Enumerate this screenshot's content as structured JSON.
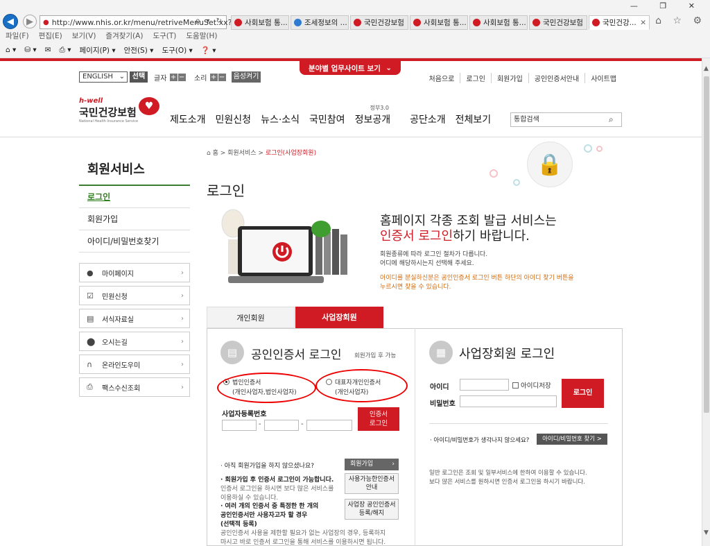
{
  "browser": {
    "address": "http://www.nhis.or.kr/menu/retriveMenuSet.xx?",
    "address_controls": "ρ ▾ ↻",
    "tabs": [
      {
        "label": "사회보험 통...",
        "icon": "red"
      },
      {
        "label": "조세정보의 ...",
        "icon": "blue"
      },
      {
        "label": "국민건강보험",
        "icon": "red"
      },
      {
        "label": "사회보험 통...",
        "icon": "red"
      },
      {
        "label": "사회보험 통...",
        "icon": "red"
      },
      {
        "label": "국민건강보험",
        "icon": "red"
      },
      {
        "label": "국민건강...",
        "icon": "red",
        "active": true
      }
    ],
    "window_controls": "— ❐ ✕",
    "toolbar_icons": "⌂ ☆ ⚙",
    "menubar": [
      "파일(F)",
      "편집(E)",
      "보기(V)",
      "즐겨찾기(A)",
      "도구(T)",
      "도움말(H)"
    ],
    "cmdbar": [
      "⌂ ▾",
      "⛁ ▾",
      "✉",
      "⎙ ▾",
      "페이지(P) ▾",
      "안전(S) ▾",
      "도구(O) ▾",
      "❓ ▾"
    ]
  },
  "top": {
    "field_sites_btn": "분야별 업무사이트 보기",
    "language": "ENGLISH",
    "select_btn": "선택",
    "font_label": "글자",
    "sound_label": "소리",
    "voice_btn": "음성켜기",
    "util_links": [
      "처음으로",
      "로그인",
      "회원가입",
      "공인인증서안내",
      "사이트맵"
    ]
  },
  "header": {
    "logo_hwell": "h-well",
    "logo_ko": "국민건강보험",
    "logo_en": "National Health Insurance Service",
    "gnb": [
      "제도소개",
      "민원신청",
      "뉴스·소식",
      "국민참여",
      "정보공개",
      "공단소개",
      "전체보기"
    ],
    "gov_label": "정부3.0",
    "search_placeholder": "통합검색"
  },
  "sidebar": {
    "title": "회원서비스",
    "items": [
      "로그인",
      "회원가입",
      "아이디/비밀번호찾기"
    ],
    "boxes": [
      {
        "label": "마이페이지",
        "icon": "person-icon"
      },
      {
        "label": "민원신청",
        "icon": "checkbox-icon"
      },
      {
        "label": "서식자료실",
        "icon": "document-icon"
      },
      {
        "label": "오시는길",
        "icon": "location-pin-icon"
      },
      {
        "label": "온라인도우미",
        "icon": "headset-icon"
      },
      {
        "label": "팩스수신조회",
        "icon": "fax-icon"
      }
    ]
  },
  "main": {
    "breadcrumb_home": "홈",
    "breadcrumb_mid": "회원서비스",
    "breadcrumb_current": "로그인(사업장회원)",
    "title": "로그인",
    "hero_line1": "홈페이지 각종 조회 발급 서비스는",
    "hero_line2_red": "인증서 로그인",
    "hero_line2_rest": "하기 바랍니다.",
    "hero_sub1": "회원종류에 따라 로그인 절차가 다릅니다.",
    "hero_sub2": "어디에 해당하시는지 선택해 주세요.",
    "hero_warn1": "아이디를 분실하신분은 공인인증서 로그인 버튼 하단의 아이디 찾기 버튼을",
    "hero_warn2": "누르시면 찾을 수 있습니다.",
    "tab_personal": "개인회원",
    "tab_biz": "사업장회원"
  },
  "cert": {
    "title": "공인인증서 로그인",
    "note": "회원가입 후 가능",
    "opt1_line1": "법인인증서",
    "opt1_line2": "(개인사업자,법인사업자)",
    "opt2_line1": "대표자개인인증서",
    "opt2_line2": "(개인사업자)",
    "bizno_label": "사업자등록번호",
    "login_btn_line1": "인증서",
    "login_btn_line2": "로그인",
    "info1": "· 아직 회원가입을 하지 않으셨나요?",
    "join_btn": "회원가입",
    "info2": "· 회원가입 후 인증서 로그인이 가능합니다.",
    "info2_sub1": "인증서 로그인을 하시면 보다 많은 서비스를",
    "info2_sub2": "이용하실 수 있습니다.",
    "btn_usable_1": "사용가능한인증서",
    "btn_usable_2": "안내",
    "info3_1": "· 여러 개의 인증서 중 특정한 한 개의",
    "info3_2": "공인인증서만 사용자고자 할 경우",
    "info3_3": "(선택적 등록)",
    "info3_sub1": "공인인증서 사용을 제한할 필요가 없는 사업장의 경우, 등록하지",
    "info3_sub2": "마시고 바로 인증서 로그인을 통해 서비스를 이용하시면 됩니다.",
    "btn_register_1": "사업장 공인인증서",
    "btn_register_2": "등록/해지"
  },
  "biz": {
    "title": "사업장회원 로그인",
    "id_label": "아이디",
    "pw_label": "비밀번호",
    "save_id": "아이디저장",
    "login_btn": "로그인",
    "forgot_text": "· 아이디/비밀번호가 생각나지 않으세요?",
    "forgot_btn": "아이디/비밀번호 찾기 >",
    "note1": "일반 로그인은 조회 및 일부서비스에 한하여 이용할 수 있습니다.",
    "note2": "보다 많은 서비스를 원하시면 인증서 로그인을 하시기 바랍니다."
  },
  "colors": {
    "brand_red": "#d01b24",
    "sidebar_green": "#3a7d2e",
    "warn_orange": "#d36a0a"
  }
}
